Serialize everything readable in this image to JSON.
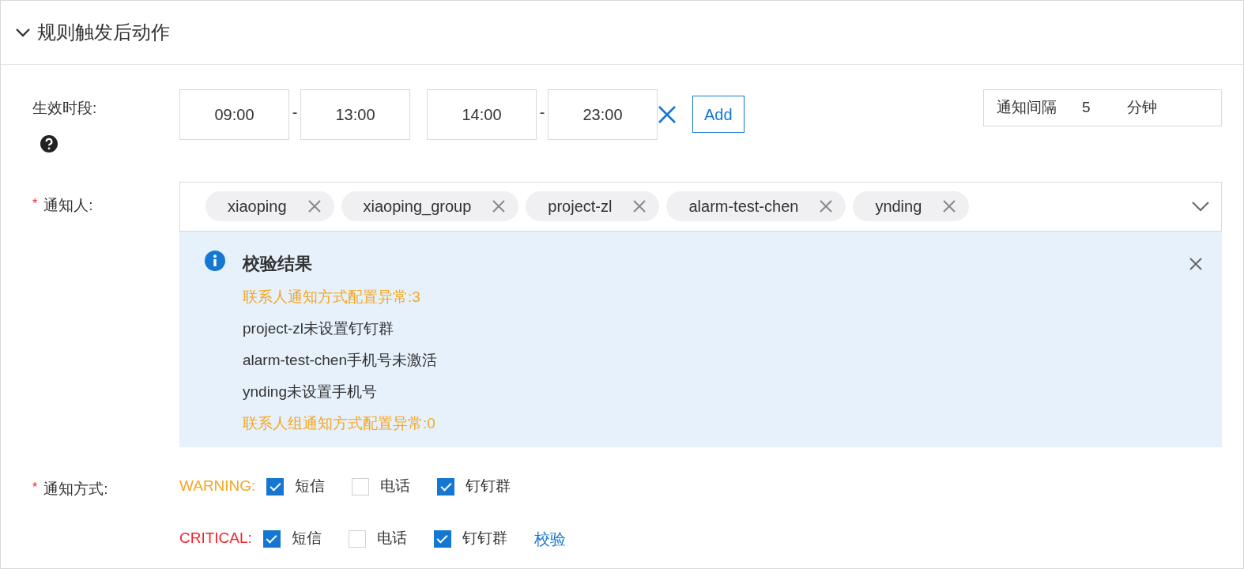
{
  "section": {
    "title": "规则触发后动作",
    "expanded": true
  },
  "time_range": {
    "label": "生效时段:",
    "ranges": [
      {
        "start": "09:00",
        "separator": "-",
        "end": "13:00"
      },
      {
        "start": "14:00",
        "separator": "-",
        "end": "23:00"
      }
    ],
    "add_button": "Add"
  },
  "interval": {
    "label": "通知间隔",
    "value": "5",
    "unit": "分钟"
  },
  "recipients": {
    "required_mark": "*",
    "label": "通知人:",
    "tags": [
      "xiaoping",
      "xiaoping_group",
      "project-zl",
      "alarm-test-chen",
      "ynding"
    ]
  },
  "validation": {
    "title": "校验结果",
    "lines": [
      {
        "kind": "summary",
        "text": "联系人通知方式配置异常:3"
      },
      {
        "kind": "detail",
        "text": "project-zl未设置钉钉群"
      },
      {
        "kind": "detail",
        "text": "alarm-test-chen手机号未激活"
      },
      {
        "kind": "detail",
        "text": "ynding未设置手机号"
      },
      {
        "kind": "summary",
        "text": "联系人组通知方式配置异常:0"
      }
    ]
  },
  "methods": {
    "required_mark": "*",
    "label": "通知方式:",
    "levels": [
      {
        "name": "WARNING:",
        "color": "#f5a623",
        "options": [
          {
            "label": "短信",
            "checked": true
          },
          {
            "label": "电话",
            "checked": false
          },
          {
            "label": "钉钉群",
            "checked": true
          }
        ]
      },
      {
        "name": "CRITICAL:",
        "color": "#f5222d",
        "options": [
          {
            "label": "短信",
            "checked": true
          },
          {
            "label": "电话",
            "checked": false
          },
          {
            "label": "钉钉群",
            "checked": true
          }
        ],
        "link": "校验"
      }
    ]
  }
}
